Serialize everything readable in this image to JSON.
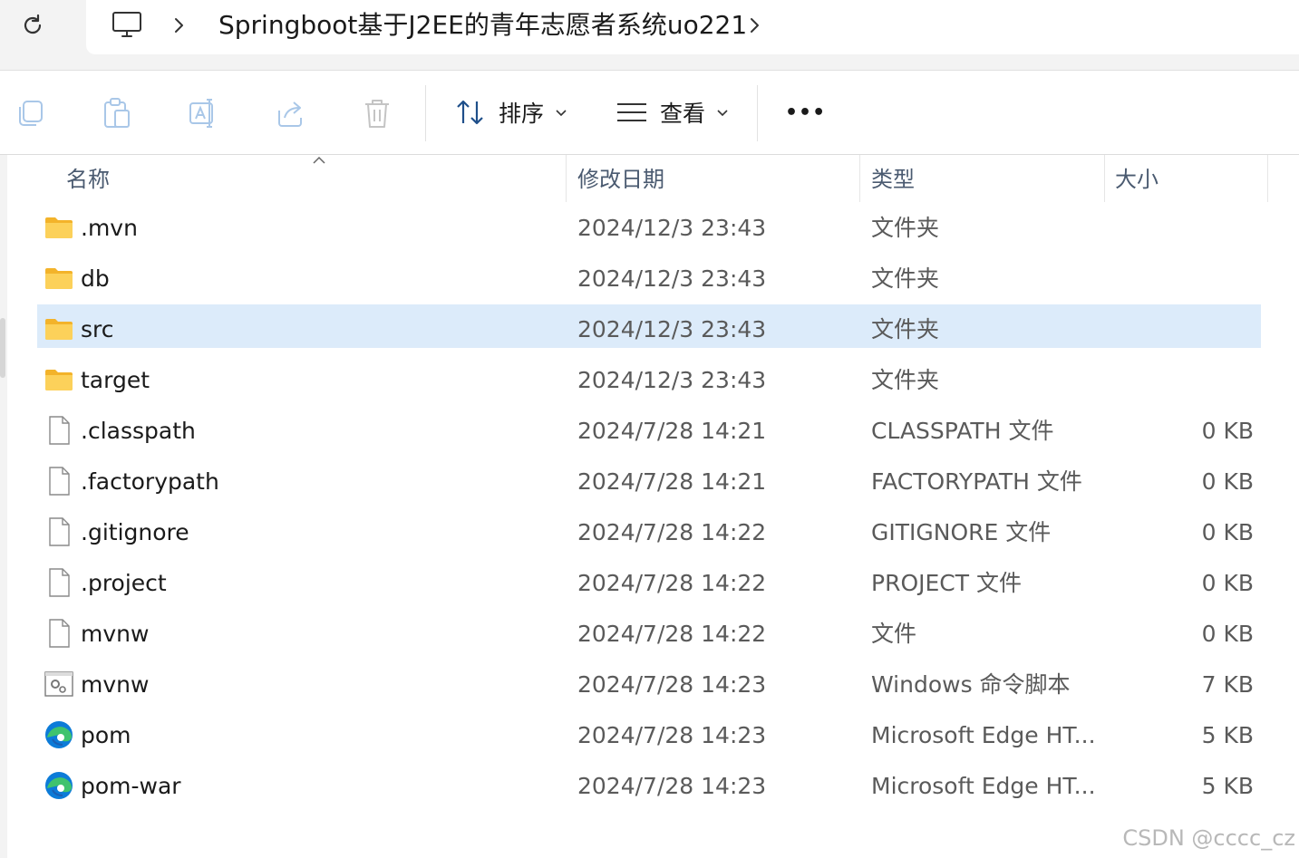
{
  "address_bar": {
    "path_label": "Springboot基于J2EE的青年志愿者系统uo221"
  },
  "toolbar": {
    "sort_label": "排序",
    "view_label": "查看",
    "more_label": "•••"
  },
  "columns": {
    "name": "名称",
    "date": "修改日期",
    "type": "类型",
    "size": "大小"
  },
  "files": [
    {
      "name": ".mvn",
      "date": "2024/12/3 23:43",
      "type": "文件夹",
      "size": "",
      "icon": "folder-icon"
    },
    {
      "name": "db",
      "date": "2024/12/3 23:43",
      "type": "文件夹",
      "size": "",
      "icon": "folder-icon"
    },
    {
      "name": "src",
      "date": "2024/12/3 23:43",
      "type": "文件夹",
      "size": "",
      "icon": "folder-icon",
      "selected": true
    },
    {
      "name": "target",
      "date": "2024/12/3 23:43",
      "type": "文件夹",
      "size": "",
      "icon": "folder-icon"
    },
    {
      "name": ".classpath",
      "date": "2024/7/28 14:21",
      "type": "CLASSPATH 文件",
      "size": "0 KB",
      "icon": "file-icon"
    },
    {
      "name": ".factorypath",
      "date": "2024/7/28 14:21",
      "type": "FACTORYPATH 文件",
      "size": "0 KB",
      "icon": "file-icon"
    },
    {
      "name": ".gitignore",
      "date": "2024/7/28 14:22",
      "type": "GITIGNORE 文件",
      "size": "0 KB",
      "icon": "file-icon"
    },
    {
      "name": ".project",
      "date": "2024/7/28 14:22",
      "type": "PROJECT 文件",
      "size": "0 KB",
      "icon": "file-icon"
    },
    {
      "name": "mvnw",
      "date": "2024/7/28 14:22",
      "type": "文件",
      "size": "0 KB",
      "icon": "file-icon"
    },
    {
      "name": "mvnw",
      "date": "2024/7/28 14:23",
      "type": "Windows 命令脚本",
      "size": "7 KB",
      "icon": "script-icon"
    },
    {
      "name": "pom",
      "date": "2024/7/28 14:23",
      "type": "Microsoft Edge HT...",
      "size": "5 KB",
      "icon": "edge-icon"
    },
    {
      "name": "pom-war",
      "date": "2024/7/28 14:23",
      "type": "Microsoft Edge HT...",
      "size": "5 KB",
      "icon": "edge-icon"
    }
  ],
  "watermark": "CSDN @cccc_cz",
  "colors": {
    "selected_row": "#dcebfa",
    "folder": "#f8c03d",
    "edge_blue": "#0c7bd8",
    "edge_green": "#3fc36e"
  }
}
